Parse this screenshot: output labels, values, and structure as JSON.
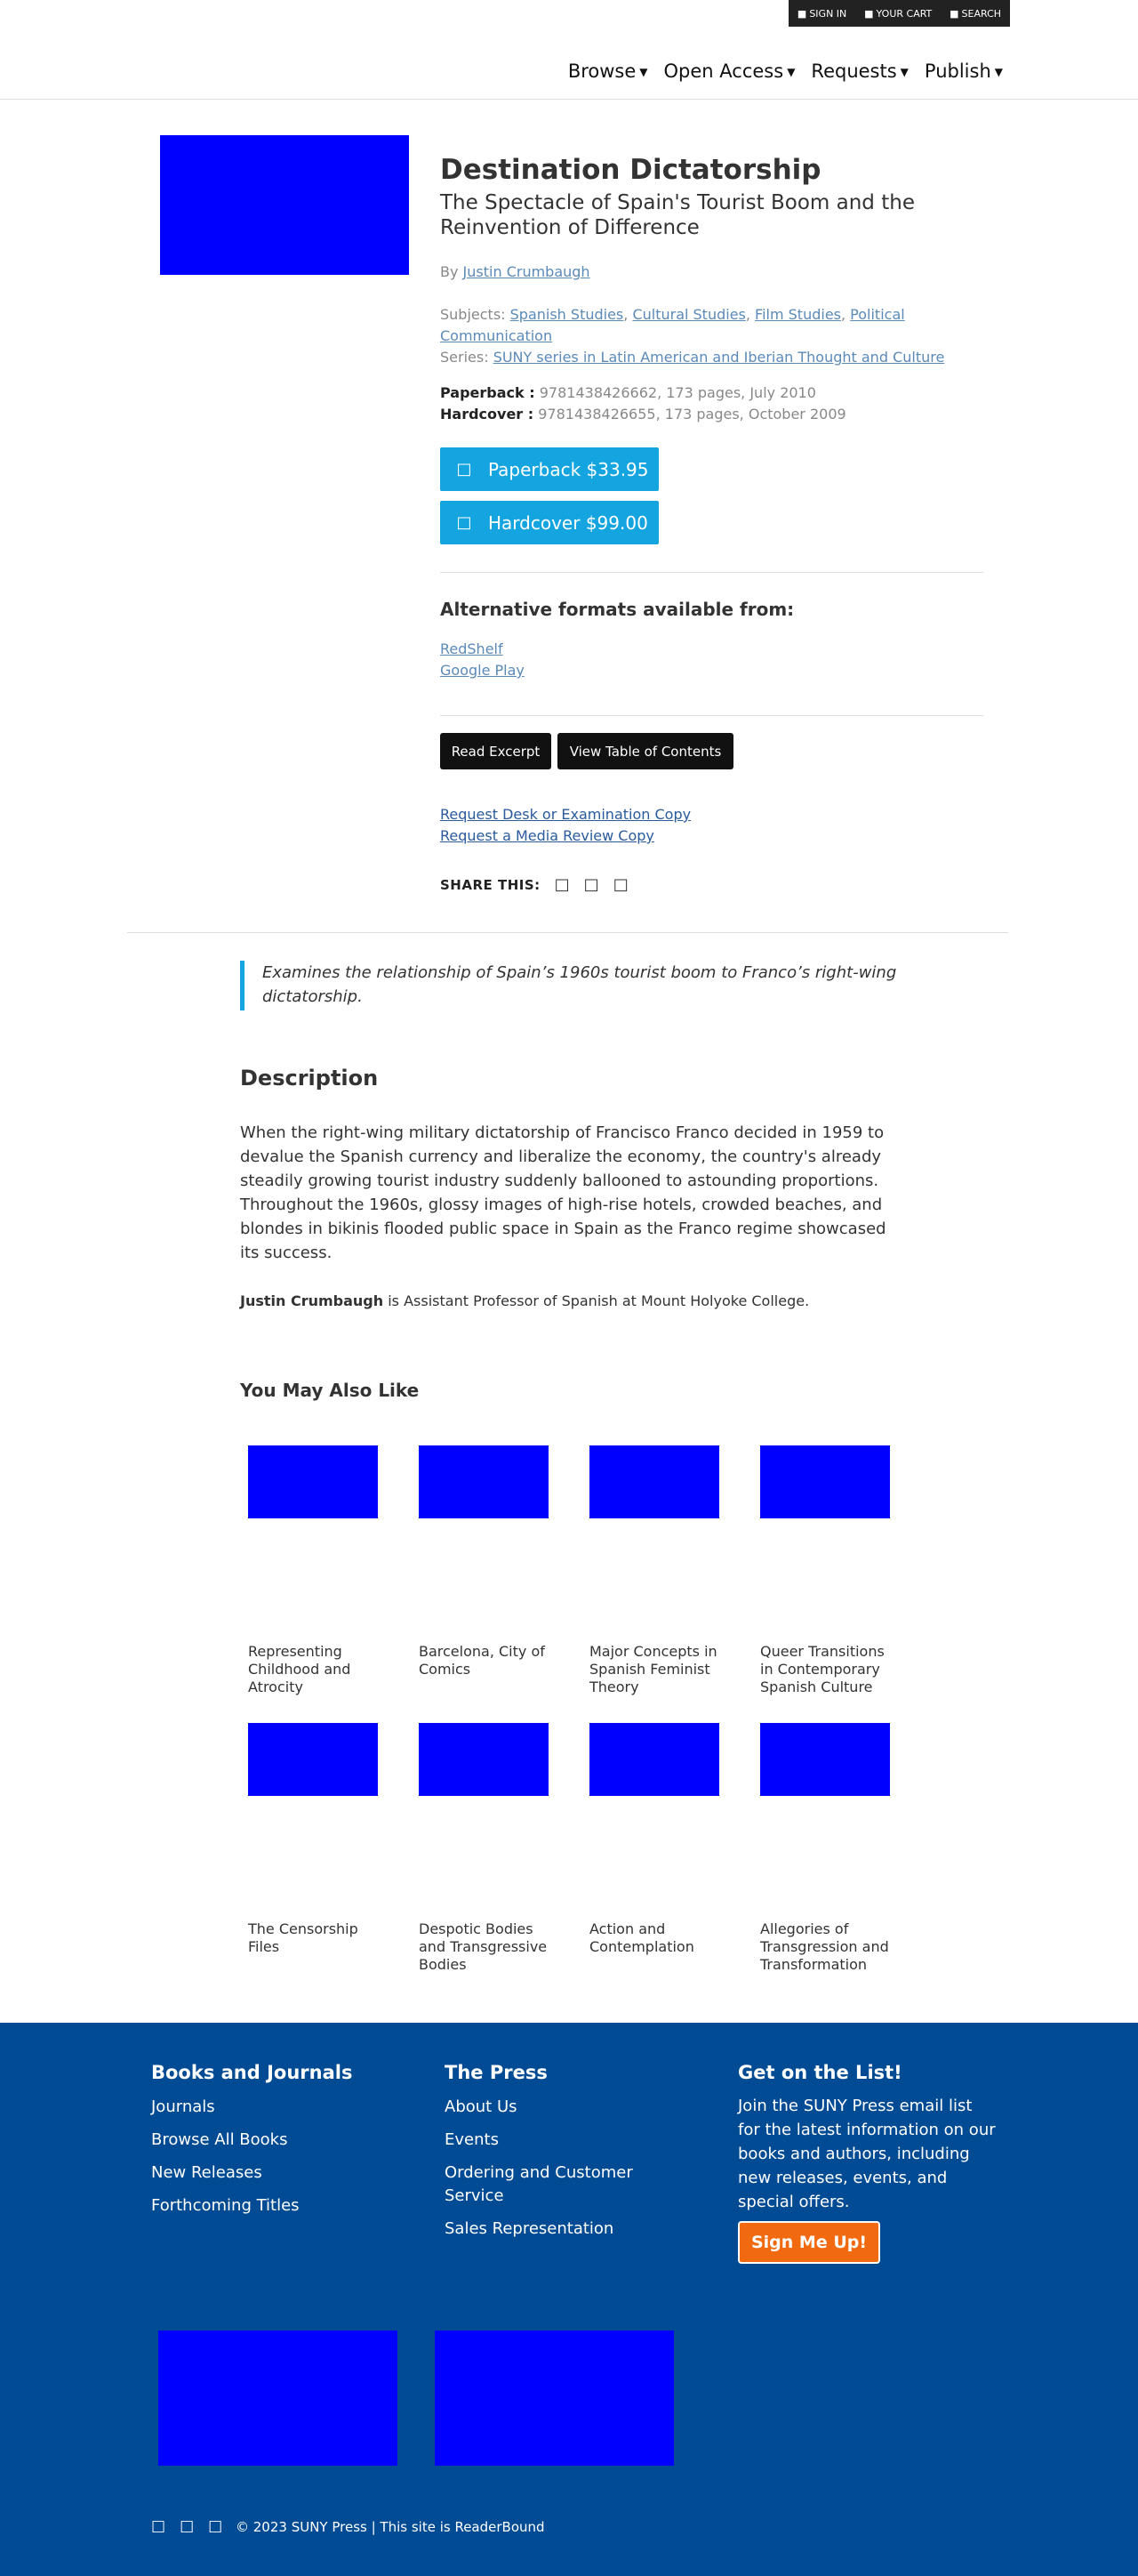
{
  "utility": {
    "sign_in": "SIGN IN",
    "cart": "YOUR CART",
    "search": "SEARCH"
  },
  "nav": {
    "items": [
      {
        "label": "Browse"
      },
      {
        "label": "Open Access"
      },
      {
        "label": "Requests"
      },
      {
        "label": "Publish"
      }
    ]
  },
  "book": {
    "title": "Destination Dictatorship",
    "subtitle": "The Spectacle of Spain's Tourist Boom and the Reinvention of Difference",
    "by_label": "By",
    "author": "Justin Crumbaugh",
    "subjects_label": "Subjects:",
    "subjects": [
      "Spanish Studies",
      "Cultural Studies",
      "Film Studies",
      "Political Communication"
    ],
    "series_label": "Series:",
    "series": "SUNY series in Latin American and Iberian Thought and Culture",
    "formats": [
      {
        "label": "Paperback :",
        "detail": "9781438426662, 173 pages, July 2010"
      },
      {
        "label": "Hardcover :",
        "detail": "9781438426655, 173 pages, October 2009"
      }
    ],
    "buy_buttons": [
      {
        "label": "Paperback $33.95"
      },
      {
        "label": "Hardcover $99.00"
      }
    ],
    "alt_formats_heading": "Alternative formats available from:",
    "alt_formats": [
      "RedShelf",
      "Google Play"
    ],
    "read_excerpt": "Read Excerpt",
    "view_toc": "View Table of Contents",
    "request_desk": "Request Desk or Examination Copy",
    "request_media": "Request a Media Review Copy",
    "share_label": "SHARE THIS:"
  },
  "description": {
    "tagline": "Examines the relationship of Spain’s 1960s tourist boom to Franco’s right-wing dictatorship.",
    "heading": "Description",
    "body": "When the right-wing military dictatorship of Francisco Franco decided in 1959 to devalue the Spanish currency and liberalize the economy, the country's already steadily growing tourist industry suddenly ballooned to astounding proportions. Throughout the 1960s, glossy images of high-rise hotels, crowded beaches, and blondes in bikinis flooded public space in Spain as the Franco regime showcased its success.",
    "bio_name": "Justin Crumbaugh",
    "bio_text": " is Assistant Professor of Spanish at Mount Holyoke College."
  },
  "related": {
    "heading": "You May Also Like",
    "items": [
      {
        "title": "Representing Childhood and Atrocity"
      },
      {
        "title": "Barcelona, City of Comics"
      },
      {
        "title": "Major Concepts in Spanish Feminist Theory"
      },
      {
        "title": "Queer Transitions in Contemporary Spanish Culture"
      },
      {
        "title": "The Censorship Files"
      },
      {
        "title": "Despotic Bodies and Transgressive Bodies"
      },
      {
        "title": "Action and Contemplation"
      },
      {
        "title": "Allegories of Transgression and Transformation"
      }
    ]
  },
  "footer": {
    "col1": {
      "heading": "Books and Journals",
      "links": [
        "Journals",
        "Browse All Books",
        "New Releases",
        "Forthcoming Titles"
      ]
    },
    "col2": {
      "heading": "The Press",
      "links": [
        "About Us",
        "Events",
        "Ordering and Customer Service",
        "Sales Representation"
      ]
    },
    "col3": {
      "heading": "Get on the List!",
      "text": "Join the SUNY Press email list for the latest information on our books and authors, including new releases, events, and special offers.",
      "button": "Sign Me Up!"
    },
    "copyright": "© 2023 SUNY Press | This site is ReaderBound"
  },
  "colors": {
    "accent": "#14a5e0",
    "footer_bg": "#004b93",
    "signup": "#f26a10",
    "placeholder_image": "#0000ff"
  }
}
